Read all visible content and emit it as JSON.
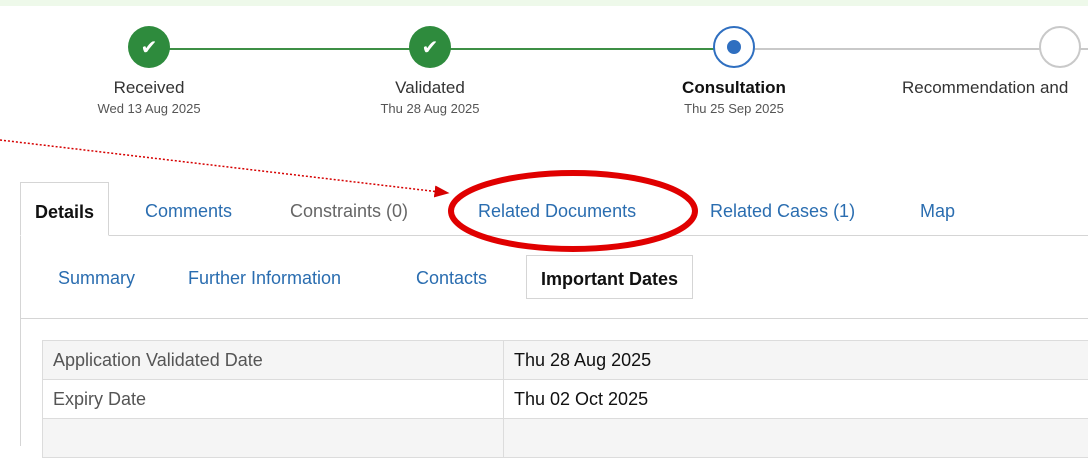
{
  "stepper": {
    "steps": [
      {
        "label": "Received",
        "date": "Wed 13 Aug 2025",
        "state": "done"
      },
      {
        "label": "Validated",
        "date": "Thu 28 Aug 2025",
        "state": "done"
      },
      {
        "label": "Consultation",
        "date": "Thu 25 Sep 2025",
        "state": "current"
      },
      {
        "label": "Recommendation and",
        "date": "",
        "state": "todo"
      }
    ]
  },
  "icons": {
    "check": "✔",
    "check_icon": "check-icon"
  },
  "tabs": {
    "details": "Details",
    "comments": "Comments",
    "constraints": "Constraints (0)",
    "related_documents": "Related Documents",
    "related_cases": "Related Cases (1)",
    "map": "Map"
  },
  "subtabs": {
    "summary": "Summary",
    "further_information": "Further Information",
    "contacts": "Contacts",
    "important_dates": "Important Dates"
  },
  "important_dates": [
    {
      "label": "Application Validated Date",
      "value": "Thu 28 Aug 2025"
    },
    {
      "label": "Expiry Date",
      "value": "Thu 02 Oct 2025"
    },
    {
      "label": "",
      "value": ""
    }
  ],
  "colors": {
    "done": "#2e8b3d",
    "current": "#2f6fc0",
    "link": "#2a6db0",
    "annotation": "#e00000"
  }
}
